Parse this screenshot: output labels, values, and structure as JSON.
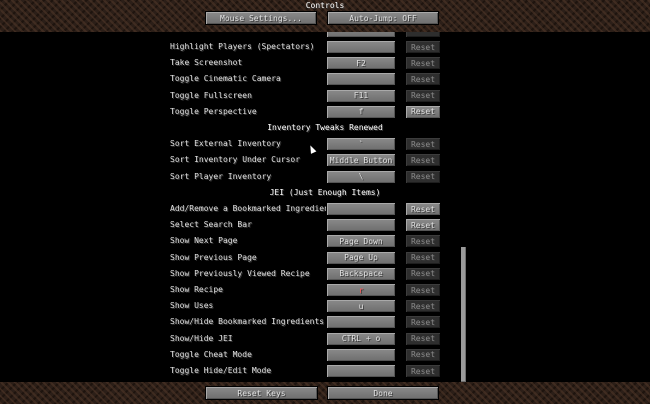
{
  "header": {
    "title": "Controls",
    "mouse_settings": "Mouse Settings...",
    "auto_jump": "Auto-Jump: OFF"
  },
  "rows": [
    {
      "label": "Highlight Players (Spectators)",
      "key": "",
      "reset": "Reset",
      "reset_enabled": false
    },
    {
      "label": "Take Screenshot",
      "key": "F2",
      "reset": "Reset",
      "reset_enabled": false
    },
    {
      "label": "Toggle Cinematic Camera",
      "key": "",
      "reset": "Reset",
      "reset_enabled": false
    },
    {
      "label": "Toggle Fullscreen",
      "key": "F11",
      "reset": "Reset",
      "reset_enabled": false
    },
    {
      "label": "Toggle Perspective",
      "key": "f",
      "reset": "Reset",
      "reset_enabled": true
    },
    {
      "category": "Inventory Tweaks Renewed"
    },
    {
      "label": "Sort External Inventory",
      "key": "`",
      "reset": "Reset",
      "reset_enabled": false
    },
    {
      "label": "Sort Inventory Under Cursor",
      "key": "Middle Button",
      "reset": "Reset",
      "reset_enabled": false
    },
    {
      "label": "Sort Player Inventory",
      "key": "\\",
      "reset": "Reset",
      "reset_enabled": false
    },
    {
      "category": "JEI (Just Enough Items)"
    },
    {
      "label": "Add/Remove a Bookmarked Ingredient",
      "key": "",
      "reset": "Reset",
      "reset_enabled": true
    },
    {
      "label": "Select Search Bar",
      "key": "",
      "reset": "Reset",
      "reset_enabled": true
    },
    {
      "label": "Show Next Page",
      "key": "Page Down",
      "reset": "Reset",
      "reset_enabled": false
    },
    {
      "label": "Show Previous Page",
      "key": "Page Up",
      "reset": "Reset",
      "reset_enabled": false
    },
    {
      "label": "Show Previously Viewed Recipe",
      "key": "Backspace",
      "reset": "Reset",
      "reset_enabled": false
    },
    {
      "label": "Show Recipe",
      "key": "r",
      "reset": "Reset",
      "reset_enabled": false,
      "conflict": true
    },
    {
      "label": "Show Uses",
      "key": "u",
      "reset": "Reset",
      "reset_enabled": false
    },
    {
      "label": "Show/Hide Bookmarked Ingredients",
      "key": "",
      "reset": "Reset",
      "reset_enabled": false
    },
    {
      "label": "Show/Hide JEI",
      "key": "CTRL + o",
      "reset": "Reset",
      "reset_enabled": false
    },
    {
      "label": "Toggle Cheat Mode",
      "key": "",
      "reset": "Reset",
      "reset_enabled": false
    },
    {
      "label": "Toggle Hide/Edit Mode",
      "key": "",
      "reset": "Reset",
      "reset_enabled": false
    }
  ],
  "footer": {
    "reset_keys": "Reset Keys",
    "done": "Done"
  }
}
